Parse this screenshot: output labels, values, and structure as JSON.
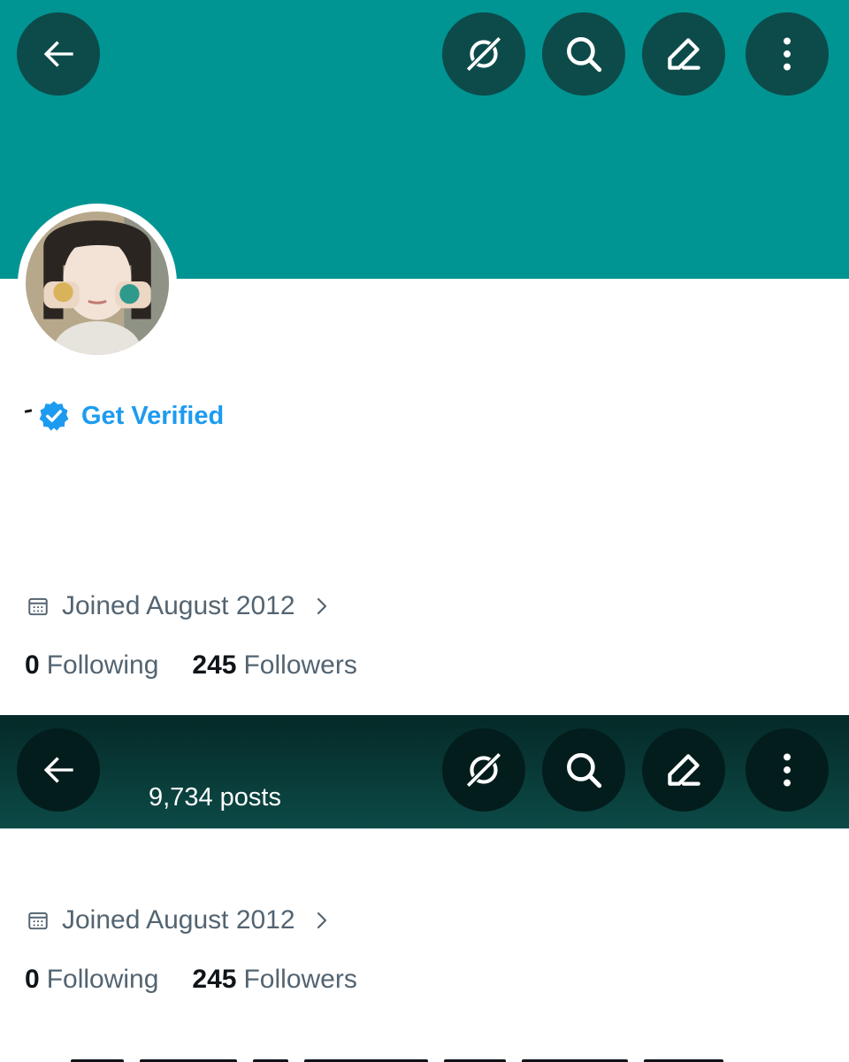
{
  "header": {
    "buttons": [
      {
        "name": "back-button",
        "icon": "back-arrow-icon"
      },
      {
        "name": "grok-button",
        "icon": "grok-icon"
      },
      {
        "name": "search-button",
        "icon": "search-icon"
      },
      {
        "name": "compose-button",
        "icon": "edit-icon"
      },
      {
        "name": "more-button",
        "icon": "more-vertical-icon"
      }
    ],
    "banner_color": "#009593"
  },
  "profile": {
    "verify_label": "Get Verified",
    "joined": "Joined August 2012",
    "following_count": "0",
    "following_label": "Following",
    "followers_count": "245",
    "followers_label": "Followers"
  },
  "sticky_header": {
    "posts_count": "9,734 posts"
  },
  "profile_repeat": {
    "joined": "Joined August 2012",
    "following_count": "0",
    "following_label": "Following",
    "followers_count": "245",
    "followers_label": "Followers"
  },
  "colors": {
    "accent": "#1d9bf0",
    "muted_text": "#536471",
    "header_button": "#0d4b4a"
  }
}
